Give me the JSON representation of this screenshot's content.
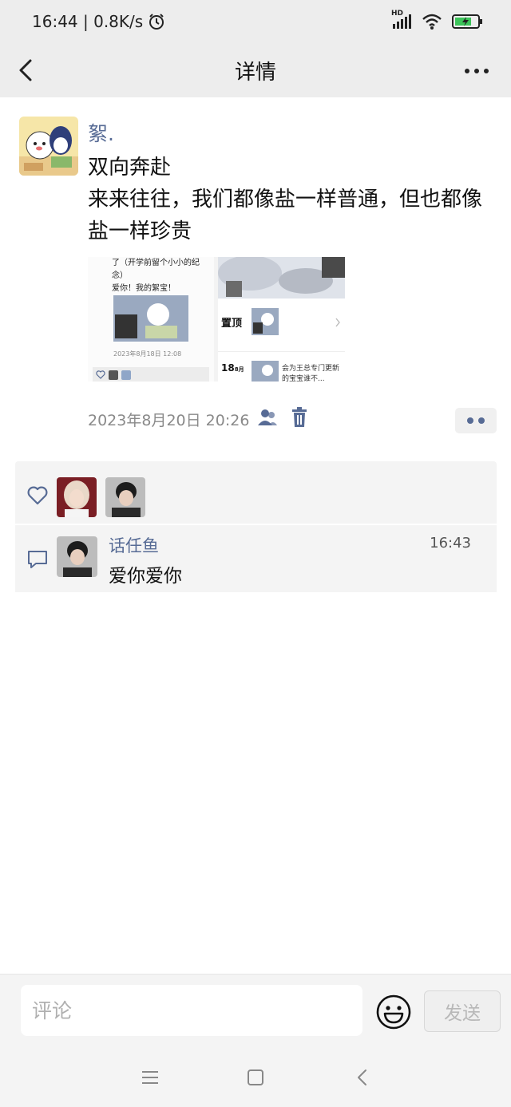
{
  "status_bar": {
    "time_speed": "16:44 | 0.8K/s",
    "network": "HD"
  },
  "nav": {
    "title": "详情"
  },
  "post": {
    "author": "絮.",
    "text_lines": [
      "双向奔赴",
      "来来往往，我们都像盐一样普通，但也都像",
      "盐一样珍贵"
    ],
    "timestamp": "2023年8月20日 20:26",
    "preview": {
      "left_caption_1": "了（开学前留个小小的纪",
      "left_caption_2": "念）",
      "left_caption_3": "爱你！我的絮宝！",
      "left_date": "2023年8月18日 12:08",
      "right_pin_label": "置顶",
      "right_day": "18",
      "right_month": "8月",
      "right_snippet_1": "会为王总专门更新",
      "right_snippet_2": "的宝宝谁不..."
    }
  },
  "likes": {
    "count_shown": 2
  },
  "comments": [
    {
      "name": "话任鱼",
      "time": "16:43",
      "text": "爱你爱你"
    }
  ],
  "input": {
    "placeholder": "评论",
    "send_label": "发送"
  },
  "colors": {
    "link": "#576b95",
    "bar_bg": "#ededed",
    "panel_bg": "#f4f4f4"
  }
}
